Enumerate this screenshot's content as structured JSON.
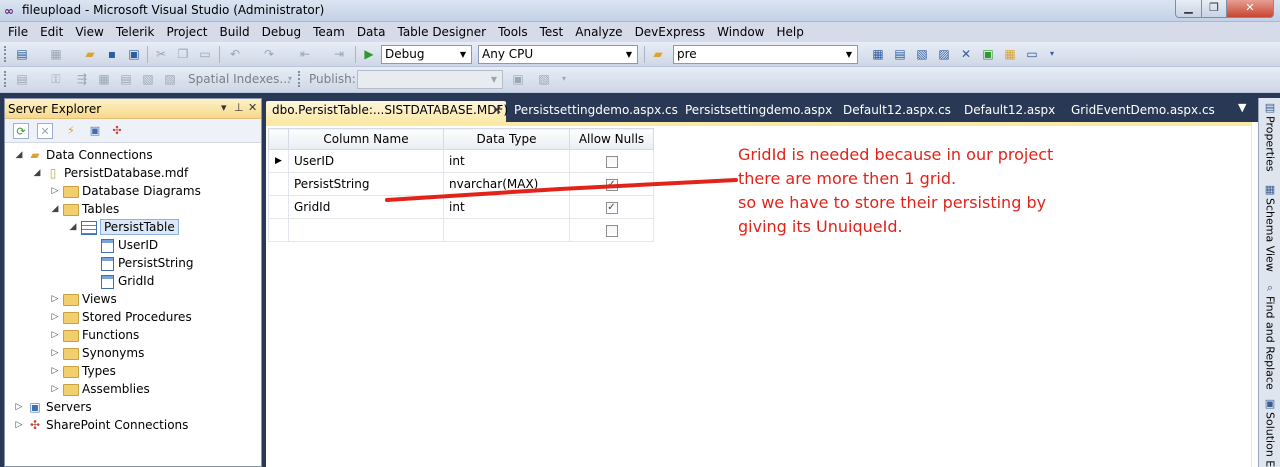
{
  "window": {
    "title": "fileupload - Microsoft Visual Studio (Administrator)",
    "app_icon": "visual-studio-icon",
    "controls": [
      "minimize",
      "maximize",
      "close"
    ]
  },
  "menu": [
    "File",
    "Edit",
    "View",
    "Telerik",
    "Project",
    "Build",
    "Debug",
    "Team",
    "Data",
    "Table Designer",
    "Tools",
    "Test",
    "Analyze",
    "DevExpress",
    "Window",
    "Help"
  ],
  "toolbar": {
    "configuration": "Debug",
    "platform": "Any CPU",
    "find_combo": "pre",
    "spatial_indexes": "Spatial Indexes...",
    "publish": "Publish:",
    "publish_value": ""
  },
  "server_explorer": {
    "title": "Server Explorer",
    "pin_icon": "pin-icon",
    "close_icon": "close-icon",
    "tree": {
      "data_connections": "Data Connections",
      "database": "PersistDatabase.mdf",
      "database_diagrams": "Database Diagrams",
      "tables": "Tables",
      "table": "PersistTable",
      "columns": [
        "UserID",
        "PersistString",
        "GridId"
      ],
      "views": "Views",
      "stored_procedures": "Stored Procedures",
      "functions": "Functions",
      "synonyms": "Synonyms",
      "types": "Types",
      "assemblies": "Assemblies",
      "servers": "Servers",
      "sharepoint": "SharePoint Connections"
    }
  },
  "doc_tabs": [
    "dbo.PersistTable:...SISTDATABASE.MDF)",
    "Persistsettingdemo.aspx.cs",
    "Persistsettingdemo.aspx",
    "Default12.aspx.cs",
    "Default12.aspx",
    "GridEventDemo.aspx.cs"
  ],
  "right_dock": [
    "Properties",
    "Schema View",
    "Find and Replace",
    "Solution E"
  ],
  "table_designer": {
    "headers": [
      "Column Name",
      "Data Type",
      "Allow Nulls"
    ],
    "rows": [
      {
        "name": "UserID",
        "type": "int",
        "allow_nulls": false
      },
      {
        "name": "PersistString",
        "type": "nvarchar(MAX)",
        "allow_nulls": true
      },
      {
        "name": "GridId",
        "type": "int",
        "allow_nulls": true
      },
      {
        "name": "",
        "type": "",
        "allow_nulls": false
      }
    ]
  },
  "annotation": {
    "lines": [
      "GridId is needed because in our project",
      "there are more then 1 grid.",
      "so we have to store their persisting by",
      "giving its UnuiqueId."
    ],
    "color": "#e2231a"
  }
}
